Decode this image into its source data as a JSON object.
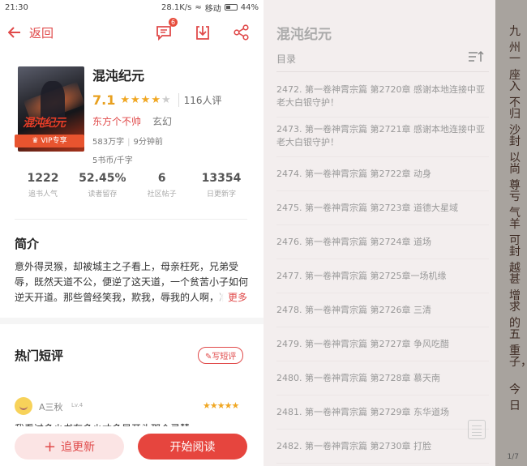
{
  "status": {
    "time": "21:30",
    "net": "28.1K/s",
    "carrier": "移动",
    "battery": "44%",
    "battery_level": 0.44
  },
  "header": {
    "back_label": "返回",
    "comment_badge": "6"
  },
  "book": {
    "title": "混沌纪元",
    "cover_title": "混沌纪元",
    "vip_label": "VIP专享",
    "score": "7.1",
    "stars_filled": 4,
    "readers": "116人评",
    "author": "东方个不帅",
    "genre": "玄幻",
    "words": "583万字",
    "updated": "9分钟前",
    "price": "5书币/千字"
  },
  "stats": [
    {
      "value": "1222",
      "label": "追书人气"
    },
    {
      "value": "52.45%",
      "label": "读者留存"
    },
    {
      "value": "6",
      "label": "社区帖子"
    },
    {
      "value": "13354",
      "label": "日更新字"
    }
  ],
  "intro": {
    "heading": "简介",
    "text": "意外得灵猴，却被城主之子看上，母亲枉死，兄弟受辱，既然天道不公，便逆了这天道，一个贫苦小子如何逆天开道。那些曾经笑我，欺我，辱我的人啊，准",
    "more_label": "更多"
  },
  "comments": {
    "heading": "热门短评",
    "write_label": "写短评",
    "items": [
      {
        "name": "A三秋",
        "level": "Lv.4",
        "text": "我看过多少书有多少才多是开头那个灵慧"
      }
    ]
  },
  "bottom": {
    "follow_label": "追更新",
    "read_label": "开始阅读"
  },
  "toc": {
    "title": "混沌纪元",
    "subtitle": "目录",
    "chapters": [
      "2472. 第一卷神霄宗篇 第2720章 感谢本地连接中亚老大白银守护！",
      "2473. 第一卷神霄宗篇 第2721章 感谢本地连接中亚老大白银守护！",
      "2474. 第一卷神霄宗篇 第2722章  动身",
      "2475. 第一卷神霄宗篇 第2723章  道德大星域",
      "2476. 第一卷神霄宗篇 第2724章  道场",
      "2477. 第一卷神霄宗篇 第2725章一场机缘",
      "2478. 第一卷神霄宗篇 第2726章  三清",
      "2479. 第一卷神霄宗篇 第2727章  争风吃醋",
      "2480. 第一卷神霄宗篇 第2728章  慕天南",
      "2481. 第一卷神霄宗篇 第2729章  东华道场",
      "2482. 第一卷神霄宗篇 第2730章  打脸"
    ],
    "page_indicator": "1/7"
  },
  "background_reading": [
    "九州",
    "一座",
    "入不",
    "归沙",
    "封以",
    "尚尊",
    "亏气",
    "羊可",
    "封越",
    "甚增",
    "求的",
    "五重",
    "子，",
    "今日"
  ]
}
